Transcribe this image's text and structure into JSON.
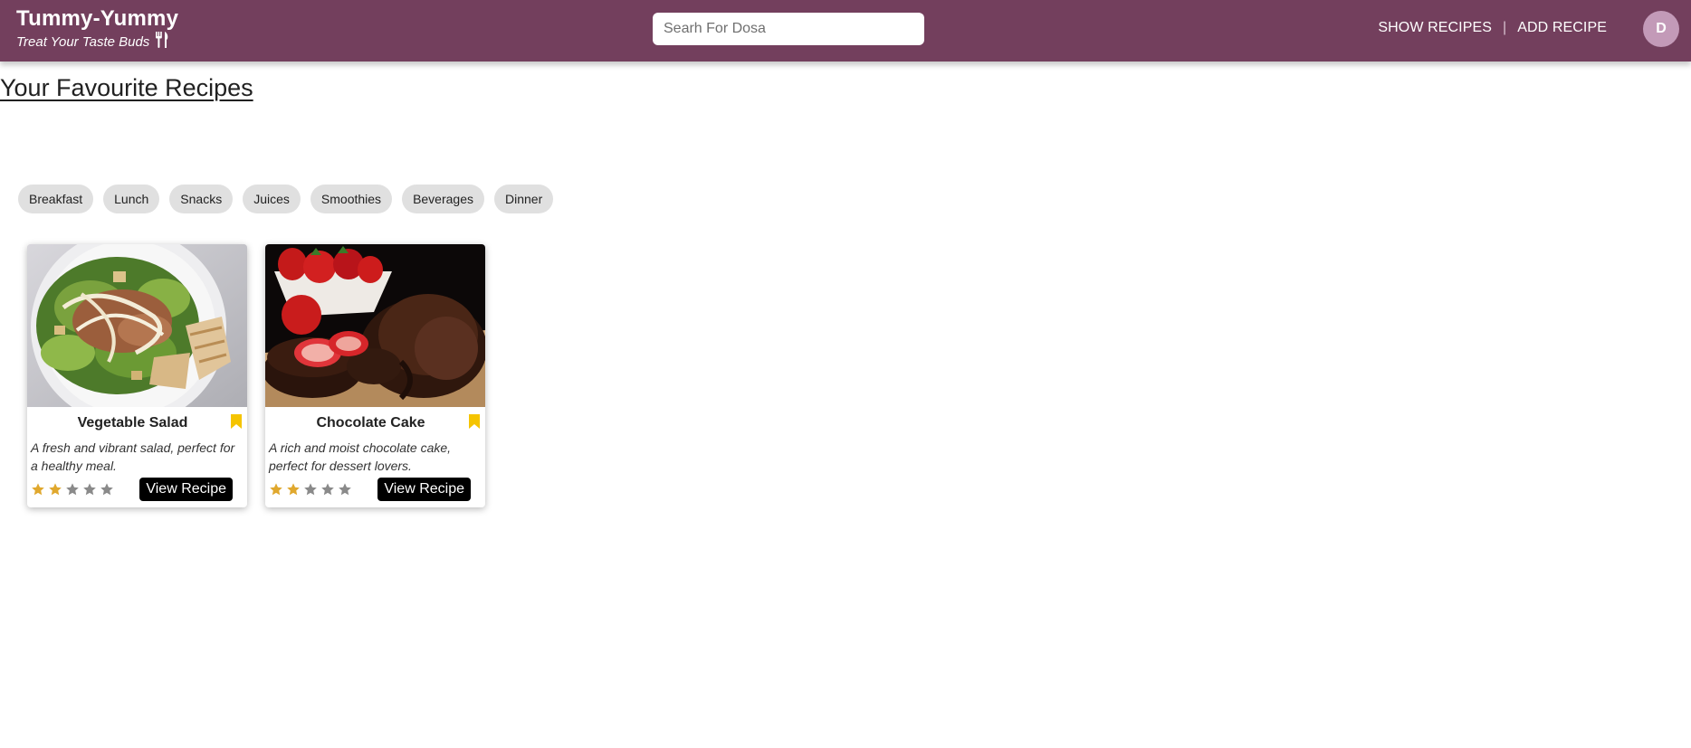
{
  "app": {
    "title": "Tummy-Yummy",
    "tagline": "Treat Your Taste Buds",
    "tagline_icon": "fork-knife-icon"
  },
  "search": {
    "placeholder": "Searh For Dosa",
    "value": ""
  },
  "nav": {
    "show_recipes": "SHOW RECIPES",
    "separator": "|",
    "add_recipe": "ADD RECIPE"
  },
  "user": {
    "avatar_initial": "D"
  },
  "page": {
    "title": "Your Favourite Recipes"
  },
  "categories": [
    "Breakfast",
    "Lunch",
    "Snacks",
    "Juices",
    "Smoothies",
    "Beverages",
    "Dinner"
  ],
  "recipes": [
    {
      "title": "Vegetable Salad",
      "description": "A fresh and vibrant salad, perfect for a healthy meal.",
      "rating": 2,
      "max_rating": 5,
      "bookmarked": true,
      "button": "View Recipe"
    },
    {
      "title": "Chocolate Cake",
      "description": "A rich and moist chocolate cake, perfect for dessert lovers.",
      "rating": 2,
      "max_rating": 5,
      "bookmarked": true,
      "button": "View Recipe"
    }
  ],
  "colors": {
    "header": "#733f5d",
    "avatar": "#c39ab8",
    "star_filled": "#e0a82e",
    "star_empty": "#8a8a8a",
    "bookmark": "#f5c400",
    "chip": "#e0e0e0"
  }
}
